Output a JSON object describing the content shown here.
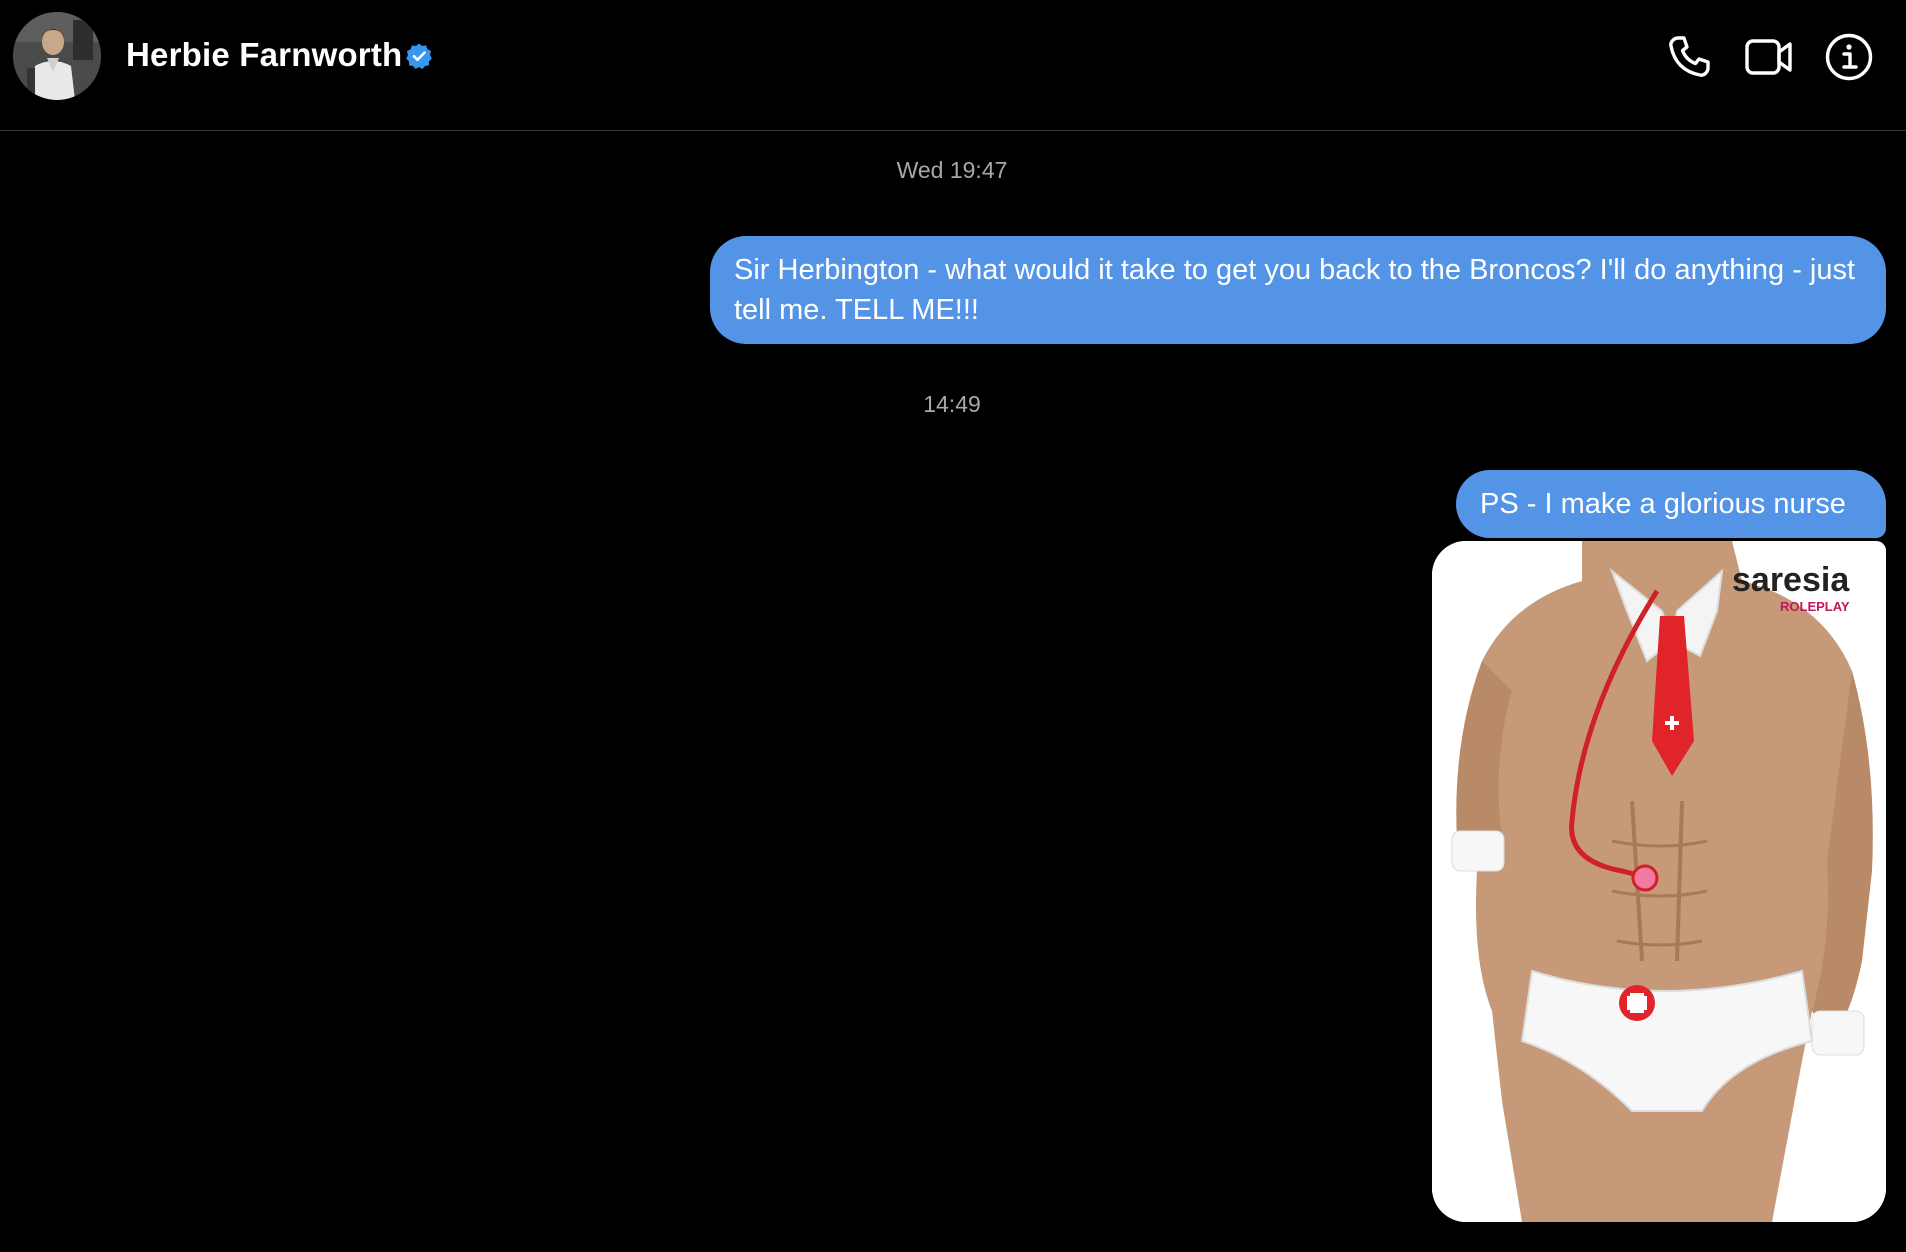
{
  "header": {
    "contact_name": "Herbie Farnworth",
    "verified": true,
    "avatar_icon": "user-avatar-photo",
    "actions": [
      {
        "name": "audio-call",
        "icon": "phone-icon"
      },
      {
        "name": "video-call",
        "icon": "video-camera-icon"
      },
      {
        "name": "conversation-info",
        "icon": "info-icon"
      }
    ]
  },
  "messages": [
    {
      "type": "timestamp",
      "text": "Wed 19:47"
    },
    {
      "type": "outgoing_text",
      "text": "Sir Herbington - what would it take to get you back to the Broncos? I'll do anything - just tell me. TELL ME!!!"
    },
    {
      "type": "timestamp",
      "text": "14:49"
    },
    {
      "type": "outgoing_text",
      "text": "PS - I make a glorious nurse"
    },
    {
      "type": "outgoing_image",
      "watermark": {
        "brand": "saresia",
        "sub": "ROLEPLAY"
      }
    }
  ],
  "colors": {
    "background": "#000000",
    "bubble_outgoing": "#5394e6",
    "timestamp_text": "#a8a8a8",
    "verified_badge": "#3797f0",
    "divider": "#3a3a3c"
  }
}
